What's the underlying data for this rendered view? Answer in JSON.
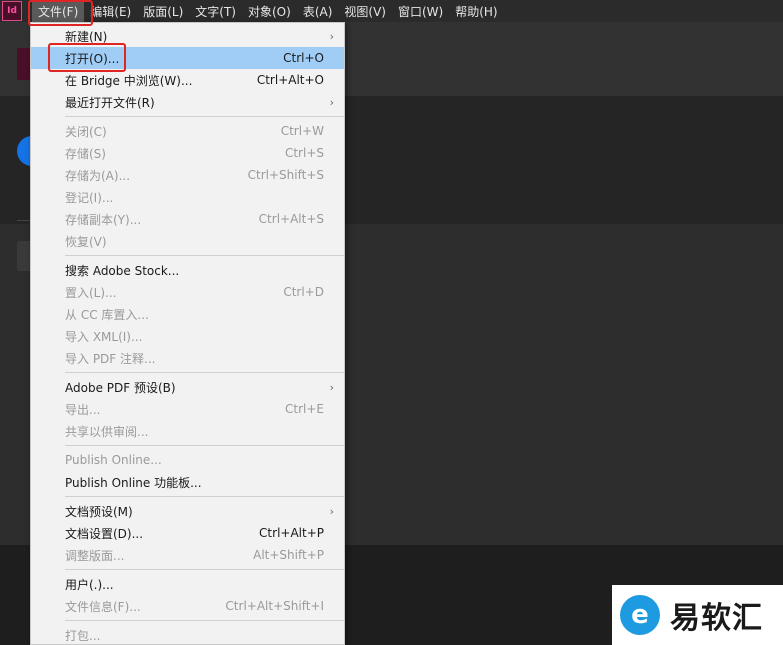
{
  "app": {
    "logo_text": "Id"
  },
  "menubar": [
    {
      "label": "文件(F)",
      "name": "menu-file",
      "active": true
    },
    {
      "label": "编辑(E)",
      "name": "menu-edit"
    },
    {
      "label": "版面(L)",
      "name": "menu-layout"
    },
    {
      "label": "文字(T)",
      "name": "menu-type"
    },
    {
      "label": "对象(O)",
      "name": "menu-object"
    },
    {
      "label": "表(A)",
      "name": "menu-table"
    },
    {
      "label": "视图(V)",
      "name": "menu-view"
    },
    {
      "label": "窗口(W)",
      "name": "menu-window"
    },
    {
      "label": "帮助(H)",
      "name": "menu-help"
    }
  ],
  "file_menu": [
    {
      "label": "新建(N)",
      "submenu": true
    },
    {
      "label": "打开(O)...",
      "shortcut": "Ctrl+O",
      "highlighted": true
    },
    {
      "label": "在 Bridge 中浏览(W)...",
      "shortcut": "Ctrl+Alt+O"
    },
    {
      "label": "最近打开文件(R)",
      "submenu": true
    },
    {
      "separator": true
    },
    {
      "label": "关闭(C)",
      "shortcut": "Ctrl+W",
      "disabled": true
    },
    {
      "label": "存储(S)",
      "shortcut": "Ctrl+S",
      "disabled": true
    },
    {
      "label": "存储为(A)...",
      "shortcut": "Ctrl+Shift+S",
      "disabled": true
    },
    {
      "label": "登记(I)...",
      "disabled": true
    },
    {
      "label": "存储副本(Y)...",
      "shortcut": "Ctrl+Alt+S",
      "disabled": true
    },
    {
      "label": "恢复(V)",
      "disabled": true
    },
    {
      "separator": true
    },
    {
      "label": "搜索 Adobe Stock..."
    },
    {
      "label": "置入(L)...",
      "shortcut": "Ctrl+D",
      "disabled": true
    },
    {
      "label": "从 CC 库置入...",
      "disabled": true
    },
    {
      "label": "导入 XML(I)...",
      "disabled": true
    },
    {
      "label": "导入 PDF 注释...",
      "disabled": true
    },
    {
      "separator": true
    },
    {
      "label": "Adobe PDF 预设(B)",
      "submenu": true
    },
    {
      "label": "导出...",
      "shortcut": "Ctrl+E",
      "disabled": true
    },
    {
      "label": "共享以供审阅...",
      "disabled": true
    },
    {
      "separator": true
    },
    {
      "label": "Publish Online...",
      "disabled": true
    },
    {
      "label": "Publish Online 功能板..."
    },
    {
      "separator": true
    },
    {
      "label": "文档预设(M)",
      "submenu": true
    },
    {
      "label": "文档设置(D)...",
      "shortcut": "Ctrl+Alt+P"
    },
    {
      "label": "调整版面...",
      "shortcut": "Alt+Shift+P",
      "disabled": true
    },
    {
      "separator": true
    },
    {
      "label": "用户(.)..."
    },
    {
      "label": "文件信息(F)...",
      "shortcut": "Ctrl+Alt+Shift+I",
      "disabled": true
    },
    {
      "separator": true
    },
    {
      "label": "打包...",
      "disabled": true
    }
  ],
  "watermark": {
    "text": "易软汇",
    "logo_glyph": "e"
  },
  "colors": {
    "highlight": "#9fcdf5",
    "annotation_red": "#e02424",
    "brand_pink": "#ff4fa0",
    "accent_blue": "#1473e6"
  }
}
